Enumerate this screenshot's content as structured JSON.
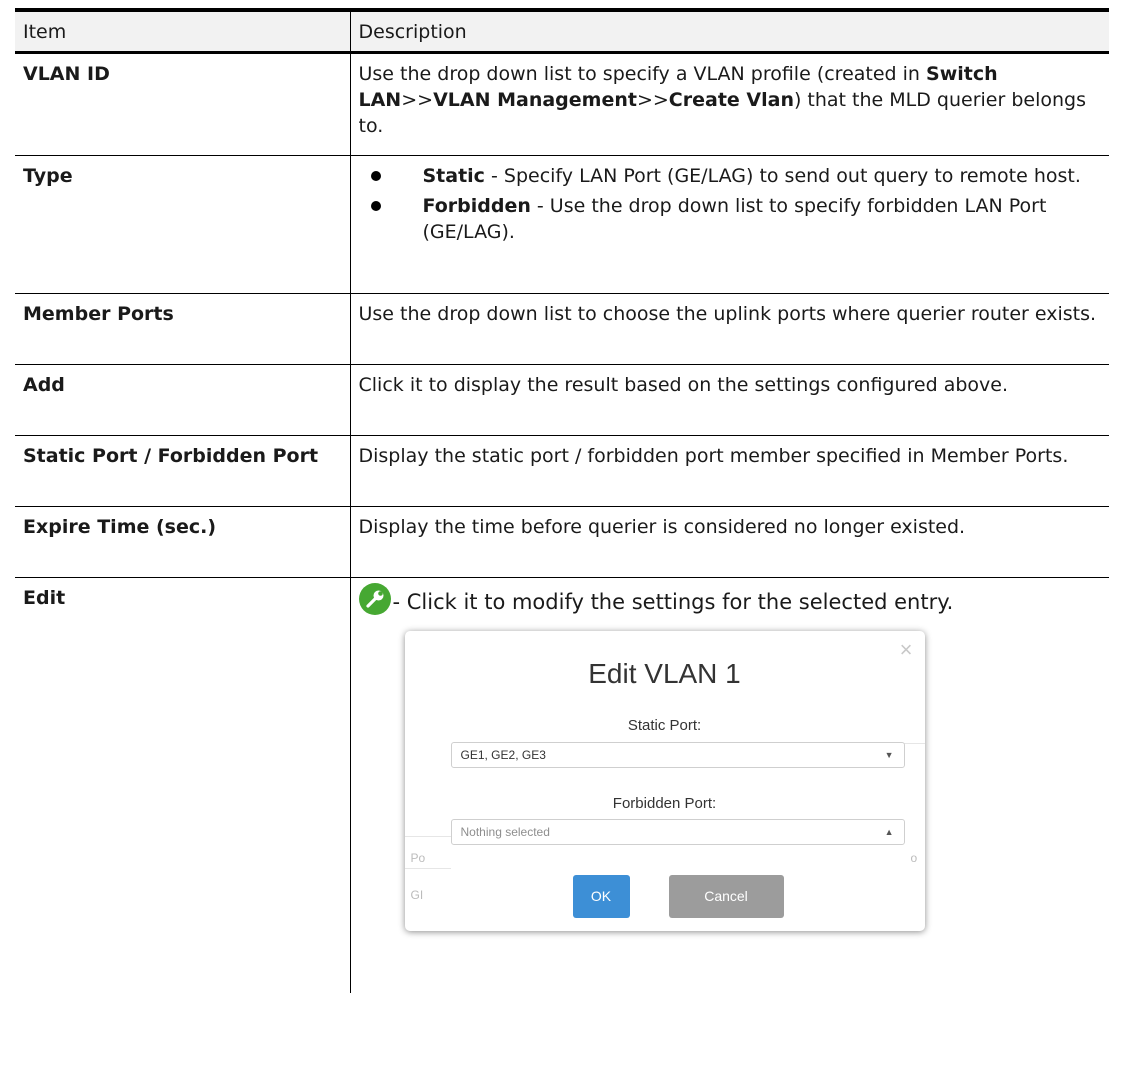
{
  "table": {
    "header": {
      "item": "Item",
      "description": "Description"
    },
    "vlan_id": {
      "item": "VLAN ID",
      "text1": "Use the drop down list to specify a VLAN profile (created in",
      "b1": "Switch LAN",
      "sep1": ">>",
      "b2": "VLAN Management",
      "sep2": ">>",
      "b3": "Create Vlan",
      "text2": ") that the MLD querier belongs to."
    },
    "type": {
      "item": "Type",
      "static_bold": "Static",
      "static_text": " - Specify LAN Port (GE/LAG) to send out query to remote host.",
      "forbidden_bold": "Forbidden",
      "forbidden_text": " - Use the drop down list to specify forbidden LAN Port (GE/LAG)."
    },
    "member_ports": {
      "item": "Member Ports",
      "desc": "Use the drop down list to choose the uplink ports where querier router exists."
    },
    "add": {
      "item": "Add",
      "desc": "Click it to display the result based on the settings configured above."
    },
    "static_forbidden": {
      "item": "Static Port / Forbidden Port",
      "desc": "Display the static port / forbidden port member specified in Member Ports."
    },
    "expire": {
      "item": "Expire Time (sec.)",
      "desc": "Display the time before querier is considered no longer existed."
    },
    "edit": {
      "item": "Edit",
      "desc": "- Click it to modify the settings for the selected entry.",
      "icon": "wrench-icon"
    }
  },
  "modal": {
    "close": "×",
    "title": "Edit VLAN 1",
    "static_label": "Static Port:",
    "static_value": "GE1, GE2, GE3",
    "forbidden_label": "Forbidden Port:",
    "forbidden_placeholder": "Nothing selected",
    "ok": "OK",
    "cancel": "Cancel",
    "caret_down": "▼",
    "caret_up": "▲",
    "ghost_left_1": "Po",
    "ghost_left_2": "GI",
    "ghost_right": "o"
  },
  "colors": {
    "ok_button": "#3d8fd6",
    "cancel_button": "#9c9c9c",
    "wrench": "#46a832"
  }
}
